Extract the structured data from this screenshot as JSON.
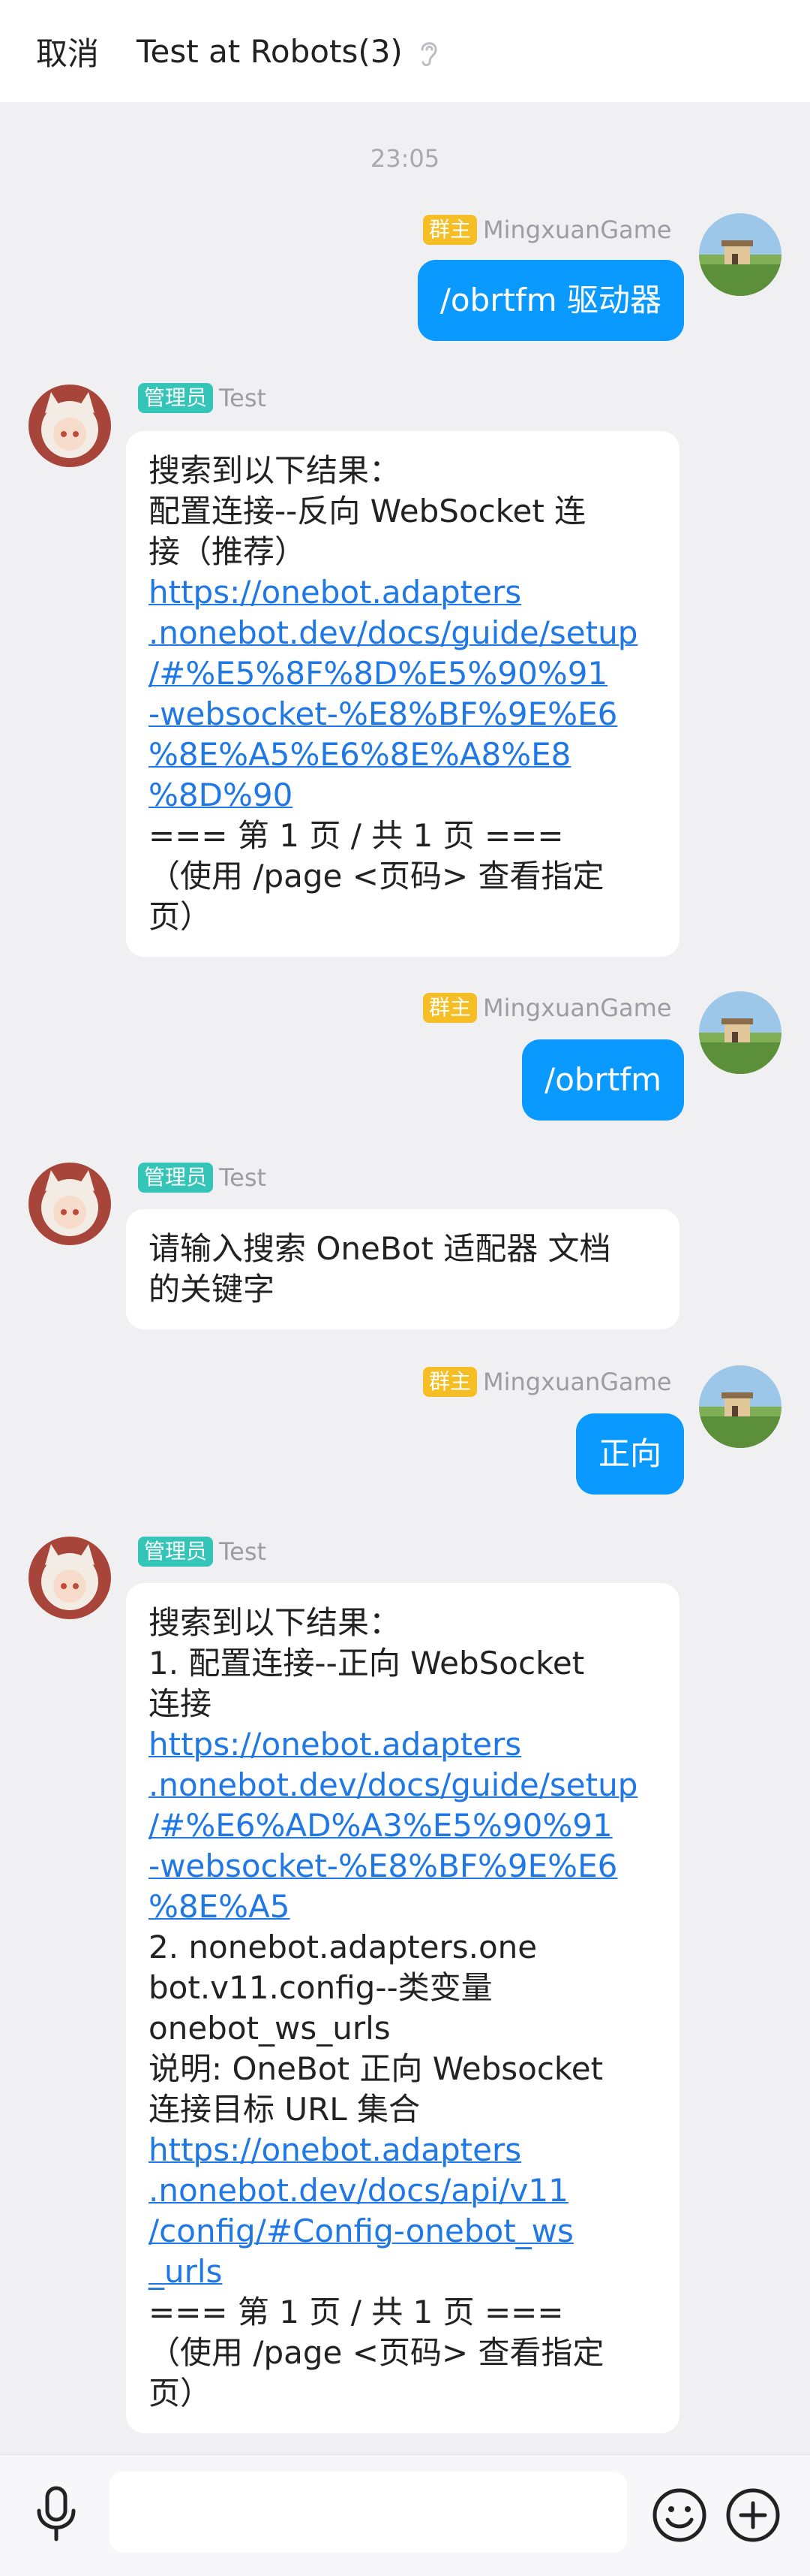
{
  "header": {
    "cancel_label": "取消",
    "title": "Test at Robots(3)"
  },
  "timestamp": "23:05",
  "colors": {
    "accent": "#0a99ff",
    "owner_badge": "#f5be25",
    "admin_badge": "#35c5b8",
    "link": "#1f78e6"
  },
  "messages": [
    {
      "direction": "out",
      "badge": "群主",
      "sender": "MingxuanGame",
      "lines": [
        "/obrtfm 驱动器"
      ]
    },
    {
      "direction": "in",
      "badge": "管理员",
      "sender": "Test",
      "lines": [
        "搜索到以下结果：",
        "配置连接--反向 WebSocket 连",
        "接（推荐）",
        "https://onebot.adapters",
        ".nonebot.dev/docs/guide/setup",
        "/#%E5%8F%8D%E5%90%91",
        "-websocket-%E8%BF%9E%E6",
        "%8E%A5%E6%8E%A8%E8",
        "%8D%90",
        "=== 第 1 页 / 共 1 页 ===",
        "（使用 /page <页码> 查看指定",
        "页）"
      ]
    },
    {
      "direction": "out",
      "badge": "群主",
      "sender": "MingxuanGame",
      "lines": [
        "/obrtfm"
      ]
    },
    {
      "direction": "in",
      "badge": "管理员",
      "sender": "Test",
      "lines": [
        "请输入搜索 OneBot 适配器 文档",
        "的关键字"
      ]
    },
    {
      "direction": "out",
      "badge": "群主",
      "sender": "MingxuanGame",
      "lines": [
        "正向"
      ]
    },
    {
      "direction": "in",
      "badge": "管理员",
      "sender": "Test",
      "lines": [
        "搜索到以下结果：",
        "1. 配置连接--正向 WebSocket",
        "连接",
        "https://onebot.adapters",
        ".nonebot.dev/docs/guide/setup",
        "/#%E6%AD%A3%E5%90%91",
        "-websocket-%E8%BF%9E%E6",
        "%8E%A5",
        "2. nonebot.adapters.one",
        "bot.v11.config--类变量",
        "onebot_ws_urls",
        "说明: OneBot 正向 Websocket",
        "连接目标 URL 集合",
        "https://onebot.adapters",
        ".nonebot.dev/docs/api/v11",
        "/config/#Config-onebot_ws",
        "_urls",
        "=== 第 1 页 / 共 1 页 ===",
        "（使用 /page <页码> 查看指定",
        "页）"
      ]
    }
  ],
  "input_bar": {
    "placeholder": "",
    "mic_icon": "microphone-icon",
    "emoji_icon": "emoji-icon",
    "add_icon": "plus-circle-icon"
  }
}
